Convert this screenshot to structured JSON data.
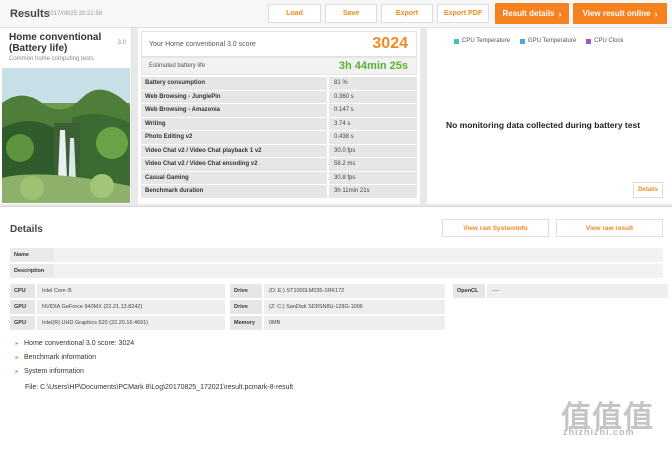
{
  "header": {
    "title": "Results",
    "date": "2017/08/25 20:21:58",
    "buttons": {
      "load": "Load",
      "save": "Save",
      "export": "Export",
      "export_pdf": "Export PDF"
    },
    "result_details": "Result details",
    "view_online": "View result online"
  },
  "test": {
    "name": "Home conventional (Battery life)",
    "version": "3.0",
    "subtitle": "Common home computing tests"
  },
  "score": {
    "label": "Your Home conventional 3.0 score",
    "value": "3024",
    "battery_label": "Estimated battery life",
    "battery_value": "3h 44min 25s"
  },
  "metrics": [
    {
      "name": "Battery consumption",
      "value": "81 %"
    },
    {
      "name": "Web Browsing - JunglePin",
      "value": "0.360 s"
    },
    {
      "name": "Web Browsing - Amazonia",
      "value": "0.147 s"
    },
    {
      "name": "Writing",
      "value": "3.74 s"
    },
    {
      "name": "Photo Editing v2",
      "value": "0.438 s"
    },
    {
      "name": "Video Chat v2 / Video Chat playback 1 v2",
      "value": "30.0 fps"
    },
    {
      "name": "Video Chat v2 / Video Chat encoding v2",
      "value": "58.2 ms"
    },
    {
      "name": "Casual Gaming",
      "value": "30.8 fps"
    },
    {
      "name": "Benchmark duration",
      "value": "3h 11min 21s"
    }
  ],
  "monitoring": {
    "legend": [
      {
        "label": "CPU Temperature",
        "color": "#3cc6b0"
      },
      {
        "label": "GPU Temperature",
        "color": "#4aa8e0"
      },
      {
        "label": "CPU Clock",
        "color": "#9b59c9"
      }
    ],
    "message": "No monitoring data collected during battery test",
    "details_button": "Details"
  },
  "details": {
    "title": "Details",
    "view_sysinfo": "View raw SystemInfo",
    "view_result": "View raw result",
    "name_label": "Name",
    "description_label": "Description",
    "hardware_col1": [
      {
        "key": "CPU",
        "value": "Intel Core i5"
      },
      {
        "key": "GPU",
        "value": "NVIDIA GeForce 940MX (22.21.13.8242)"
      },
      {
        "key": "GPU",
        "value": "Intel(R) UHD Graphics 620 (22.20.16.4691)"
      }
    ],
    "hardware_col2": [
      {
        "key": "Drive",
        "value": "(D: E:) ST1000LM035-1RK172"
      },
      {
        "key": "Drive",
        "value": "(Z: C:) SanDisk SD8SN8U-128G-1006"
      },
      {
        "key": "Memory",
        "value": "0MB"
      }
    ],
    "hardware_col3": [
      {
        "key": "OpenCL",
        "value": "----"
      }
    ],
    "sections": [
      "Home conventional 3.0 score: 3024",
      "Benchmark information",
      "System information"
    ],
    "file": "File: C:\\Users\\HP\\Documents\\PCMark 8\\Log\\20170825_172021\\result.pcmark-8-result"
  },
  "watermark": {
    "logo": "值值值",
    "site": "zhizhizhi.com"
  },
  "colors": {
    "accent": "#f5821f",
    "battery_green": "#5cb033"
  }
}
